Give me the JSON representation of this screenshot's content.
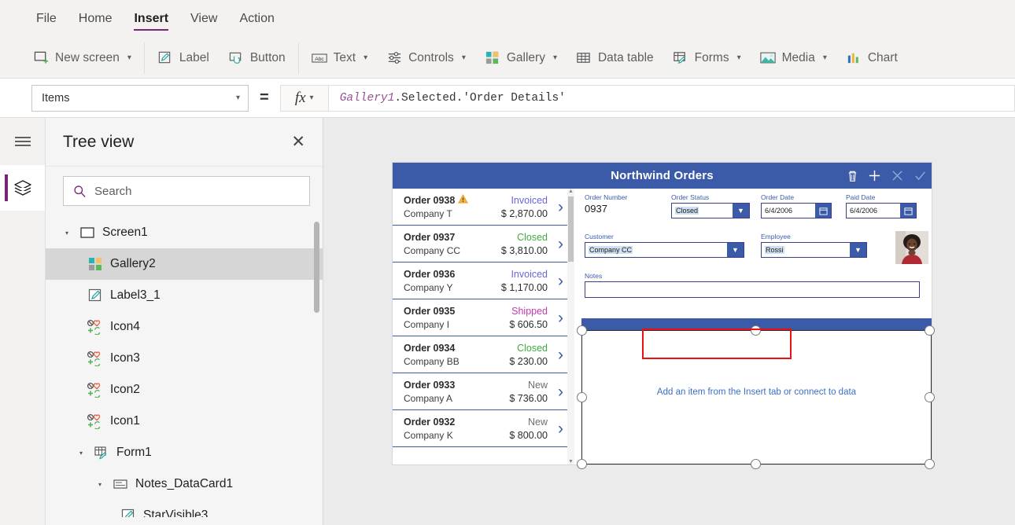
{
  "menu": {
    "items": [
      {
        "label": "File",
        "active": false
      },
      {
        "label": "Home",
        "active": false
      },
      {
        "label": "Insert",
        "active": true
      },
      {
        "label": "View",
        "active": false
      },
      {
        "label": "Action",
        "active": false
      }
    ]
  },
  "ribbon": {
    "items": [
      {
        "label": "New screen",
        "icon": "new-screen-icon",
        "caret": true
      },
      {
        "label": "Label",
        "icon": "label-icon",
        "caret": false
      },
      {
        "label": "Button",
        "icon": "button-icon",
        "caret": false
      },
      {
        "label": "Text",
        "icon": "text-icon",
        "caret": true
      },
      {
        "label": "Controls",
        "icon": "controls-icon",
        "caret": true
      },
      {
        "label": "Gallery",
        "icon": "gallery-icon",
        "caret": true
      },
      {
        "label": "Data table",
        "icon": "data-table-icon",
        "caret": false
      },
      {
        "label": "Forms",
        "icon": "forms-icon",
        "caret": true
      },
      {
        "label": "Media",
        "icon": "media-icon",
        "caret": true
      },
      {
        "label": "Chart",
        "icon": "chart-icon",
        "caret": false
      }
    ]
  },
  "formula_bar": {
    "property": "Items",
    "equals": "=",
    "fx": "fx",
    "formula_object": "Gallery1",
    "formula_rest": ".Selected.'Order Details'"
  },
  "tree": {
    "title": "Tree view",
    "close": "✕",
    "search_placeholder": "Search",
    "items": [
      {
        "label": "Screen1",
        "icon": "screen-icon",
        "depth": 0,
        "twisty": "▾",
        "selected": false
      },
      {
        "label": "Gallery2",
        "icon": "gallery-icon",
        "depth": 1,
        "twisty": "",
        "selected": true
      },
      {
        "label": "Label3_1",
        "icon": "label-icon",
        "depth": 1,
        "twisty": "",
        "selected": false
      },
      {
        "label": "Icon4",
        "icon": "icons-icon",
        "depth": 1,
        "twisty": "",
        "selected": false
      },
      {
        "label": "Icon3",
        "icon": "icons-icon",
        "depth": 1,
        "twisty": "",
        "selected": false
      },
      {
        "label": "Icon2",
        "icon": "icons-icon",
        "depth": 1,
        "twisty": "",
        "selected": false
      },
      {
        "label": "Icon1",
        "icon": "icons-icon",
        "depth": 1,
        "twisty": "",
        "selected": false
      },
      {
        "label": "Form1",
        "icon": "form-icon",
        "depth": 1,
        "twisty": "▾",
        "selected": false
      },
      {
        "label": "Notes_DataCard1",
        "icon": "datacard-icon",
        "depth": 2,
        "twisty": "▾",
        "selected": false
      },
      {
        "label": "StarVisible3",
        "icon": "label-icon",
        "depth": 3,
        "twisty": "",
        "selected": false
      }
    ]
  },
  "app": {
    "title": "Northwind Orders",
    "header_icons": [
      "trash-icon",
      "plus-icon",
      "cancel-x-icon",
      "checkmark-icon"
    ],
    "gallery": [
      {
        "order": "Order 0938",
        "company": "Company T",
        "status": "Invoiced",
        "status_color": "#6666dd",
        "amount": "$ 2,870.00",
        "warning": true
      },
      {
        "order": "Order 0937",
        "company": "Company CC",
        "status": "Closed",
        "status_color": "#3faa3f",
        "amount": "$ 3,810.00",
        "warning": false
      },
      {
        "order": "Order 0936",
        "company": "Company Y",
        "status": "Invoiced",
        "status_color": "#6666dd",
        "amount": "$ 1,170.00",
        "warning": false
      },
      {
        "order": "Order 0935",
        "company": "Company I",
        "status": "Shipped",
        "status_color": "#c23bb0",
        "amount": "$ 606.50",
        "warning": false
      },
      {
        "order": "Order 0934",
        "company": "Company BB",
        "status": "Closed",
        "status_color": "#3faa3f",
        "amount": "$ 230.00",
        "warning": false
      },
      {
        "order": "Order 0933",
        "company": "Company A",
        "status": "New",
        "status_color": "#6d6d6d",
        "amount": "$ 736.00",
        "warning": false
      },
      {
        "order": "Order 0932",
        "company": "Company K",
        "status": "New",
        "status_color": "#6d6d6d",
        "amount": "$ 800.00",
        "warning": false
      }
    ],
    "form": {
      "order_number_label": "Order Number",
      "order_number_value": "0937",
      "order_status_label": "Order Status",
      "order_status_value": "Closed",
      "order_date_label": "Order Date",
      "order_date_value": "6/4/2006",
      "paid_date_label": "Paid Date",
      "paid_date_value": "6/4/2006",
      "customer_label": "Customer",
      "customer_value": "Company CC",
      "employee_label": "Employee",
      "employee_value": "Rossi",
      "notes_label": "Notes",
      "notes_value": ""
    },
    "empty_gallery_text": "Add an item from the Insert tab or connect to data"
  },
  "colors": {
    "accent_purple": "#742774",
    "app_blue": "#3b5ba9",
    "annotation_red": "#ee1111"
  }
}
